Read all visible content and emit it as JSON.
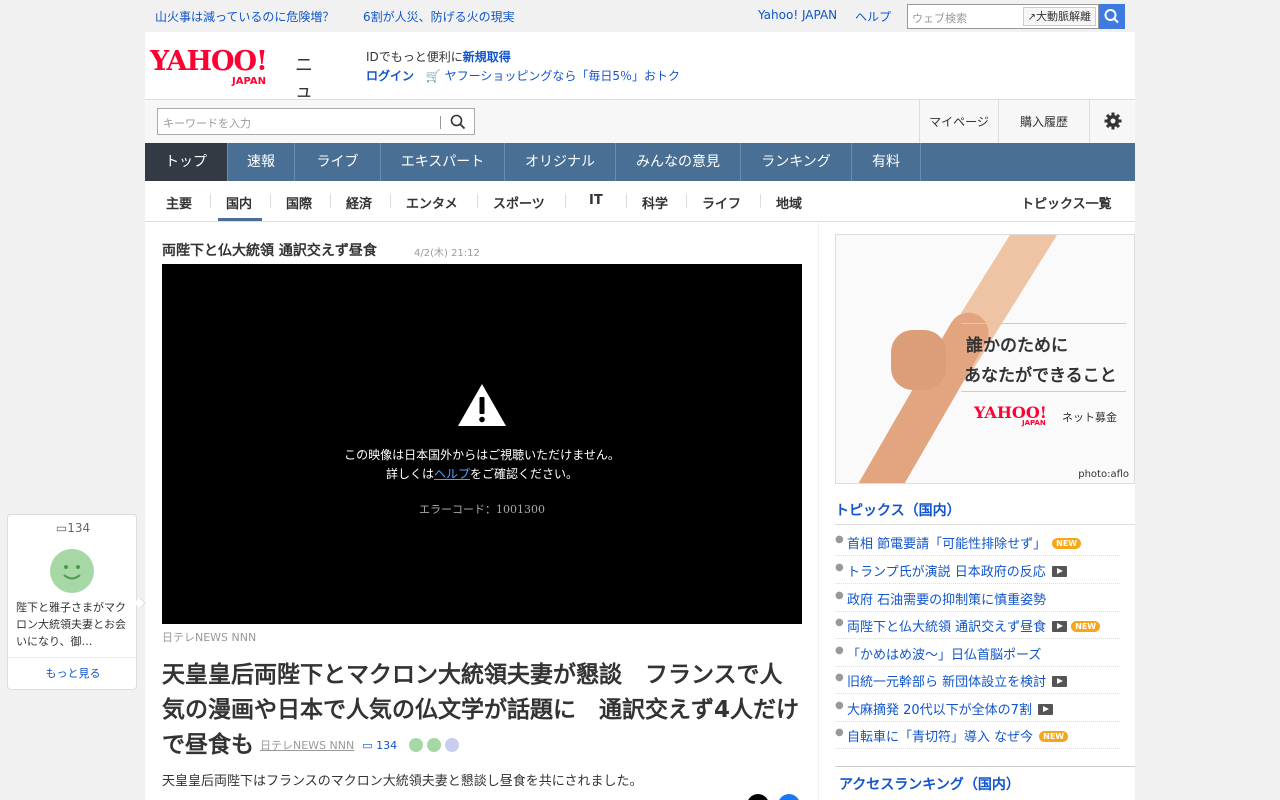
{
  "topbar": {
    "headline1": "山火事は減っているのに危険増？",
    "headline2": "6割が人災、防げる火の現実",
    "yahoo_japan": "Yahoo! JAPAN",
    "help": "ヘルプ",
    "search_placeholder": "ウェブ検索",
    "trend_button": "大動脈解離"
  },
  "header": {
    "logo_text": "YAHOO!",
    "logo_sub": "JAPAN",
    "section_name": "ニュース",
    "id_text": "IDでもっと便利に",
    "register_link": "新規取得",
    "login_link": "ログイン",
    "shopping_link": "ヤフーショッピングなら「毎日5％」おトク"
  },
  "searchrow": {
    "keyword_placeholder": "キーワードを入力",
    "mypage": "マイページ",
    "history": "購入履歴"
  },
  "mainnav": [
    {
      "label": "トップ",
      "active": true
    },
    {
      "label": "速報"
    },
    {
      "label": "ライブ"
    },
    {
      "label": "エキスパート"
    },
    {
      "label": "オリジナル"
    },
    {
      "label": "みんなの意見"
    },
    {
      "label": "ランキング"
    },
    {
      "label": "有料"
    }
  ],
  "subnav": {
    "items": [
      "主要",
      "国内",
      "国際",
      "経済",
      "エンタメ",
      "スポーツ",
      "IT",
      "科学",
      "ライフ",
      "地域"
    ],
    "active": "国内",
    "topics_link": "トピックス一覧"
  },
  "article": {
    "video_title": "両陛下と仏大統領 通訳交えず昼食",
    "video_date": "4/2(木) 21:12",
    "video_msg1": "この映像は日本国外からはご視聴いただけません。",
    "video_msg2_pre": "詳しくは",
    "video_msg2_link": "ヘルプ",
    "video_msg2_post": "をご確認ください。",
    "video_error": "エラーコード：1001300",
    "source": "日テレNEWS NNN",
    "headline": "天皇皇后両陛下とマクロン大統領夫妻が懇談　フランスで人気の漫画や日本で人気の仏文学が話題に　通訳交えず4人だけで昼食も",
    "headline_source": "日テレNEWS NNN",
    "comment_count": "134",
    "lede": "天皇皇后両陛下はフランスのマクロン大統領夫妻と懇談し昼食を共にされました。"
  },
  "comment_card": {
    "count": "134",
    "text": "陛下と雅子さまがマクロン大統領夫妻とお会いになり、御…",
    "more": "もっと見る"
  },
  "ad": {
    "line1": "誰かのために",
    "line2": "あなたができること",
    "brand": "YAHOO!",
    "brand_sub": "JAPAN",
    "service": "ネット募金",
    "credit": "photo:aflo"
  },
  "topics": {
    "heading": "トピックス（国内）",
    "items": [
      {
        "text": "首相 節電要請「可能性排除せず」",
        "new": true,
        "video": false
      },
      {
        "text": "トランプ氏が演説 日本政府の反応",
        "new": false,
        "video": true
      },
      {
        "text": "政府 石油需要の抑制策に慎重姿勢",
        "new": false,
        "video": false
      },
      {
        "text": "両陛下と仏大統領 通訳交えず昼食",
        "new": true,
        "video": true
      },
      {
        "text": "「かめはめ波～」日仏首脳ポーズ",
        "new": false,
        "video": false
      },
      {
        "text": "旧統一元幹部ら 新団体設立を検討",
        "new": false,
        "video": true
      },
      {
        "text": "大麻摘発 20代以下が全体の7割",
        "new": false,
        "video": true
      },
      {
        "text": "自転車に「青切符」導入 なぜ今",
        "new": true,
        "video": false
      }
    ],
    "new_label": "NEW"
  },
  "ranking": {
    "heading": "アクセスランキング（国内）"
  }
}
